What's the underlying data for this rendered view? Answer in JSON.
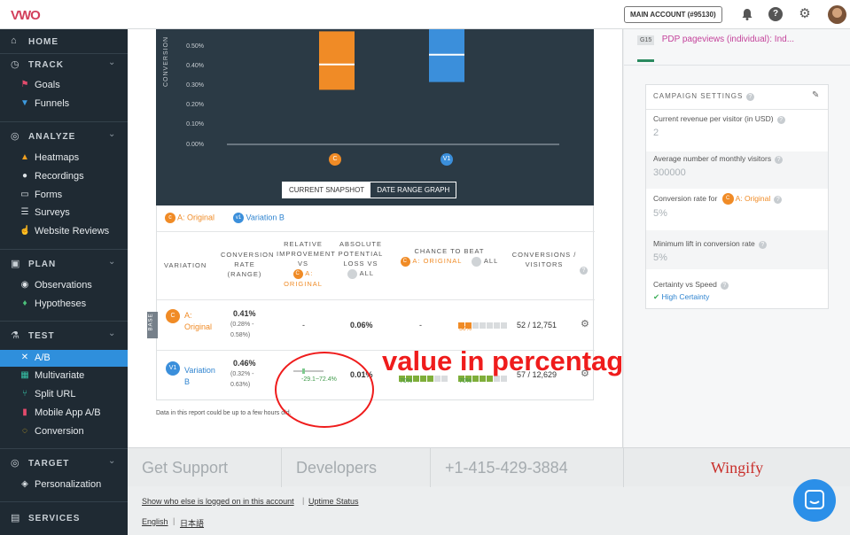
{
  "topbar": {
    "logo": "VWO",
    "account_label": "MAIN ACCOUNT (#95130)",
    "icons": [
      "bell-icon",
      "help-icon",
      "gear-icon"
    ]
  },
  "sidebar": {
    "home": "HOME",
    "track": {
      "title": "TRACK",
      "items": [
        "Goals",
        "Funnels"
      ]
    },
    "analyze": {
      "title": "ANALYZE",
      "items": [
        "Heatmaps",
        "Recordings",
        "Forms",
        "Surveys",
        "Website Reviews"
      ]
    },
    "plan": {
      "title": "PLAN",
      "items": [
        "Observations",
        "Hypotheses"
      ]
    },
    "test": {
      "title": "TEST",
      "items": [
        "A/B",
        "Multivariate",
        "Split URL",
        "Mobile App A/B",
        "Conversion"
      ]
    },
    "target": {
      "title": "TARGET",
      "items": [
        "Personalization"
      ]
    },
    "services": "SERVICES"
  },
  "chart": {
    "ylabel": "CONVERSION",
    "ticks": [
      "0.50%",
      "0.40%",
      "0.30%",
      "0.20%",
      "0.10%",
      "0.00%"
    ],
    "toggle_snapshot": "CURRENT SNAPSHOT",
    "toggle_range": "DATE RANGE GRAPH",
    "marker_c": "C",
    "marker_v1": "V1"
  },
  "chart_data": {
    "type": "box",
    "ylabel": "CONVERSION",
    "ylim": [
      0,
      0.6
    ],
    "categories": [
      "C",
      "V1"
    ],
    "series": [
      {
        "name": "A: Original",
        "low": 0.28,
        "mid": 0.41,
        "high": 0.58,
        "color": "#f08b26"
      },
      {
        "name": "Variation B",
        "low": 0.32,
        "mid": 0.46,
        "high": 0.63,
        "color": "#3b8fdb"
      }
    ]
  },
  "table": {
    "legend_a": "A: Original",
    "legend_b": "Variation B",
    "headers": {
      "variation": "VARIATION",
      "conversion_rate": "CONVERSION RATE (RANGE)",
      "relative": "RELATIVE IMPROVEMENT VS",
      "relative_ref": "A: ORIGINAL",
      "absolute": "ABSOLUTE POTENTIAL LOSS VS",
      "absolute_ref": "ALL",
      "chance": "CHANCE TO BEAT",
      "chance_ref1": "A: ORIGINAL",
      "chance_ref2": "ALL",
      "conversions": "CONVERSIONS / VISITORS"
    },
    "rows": [
      {
        "badge": "C",
        "name": "A: Original",
        "rate": "0.41%",
        "range": "(0.28% - 0.58%)",
        "relative": "-",
        "absolute": "0.06%",
        "chance1": "-",
        "chance2": "30%",
        "conv": "52 / 12,751"
      },
      {
        "badge": "V1",
        "name": "Variation B",
        "rate": "0.46%",
        "range": "(0.32% - 0.63%)",
        "relative": "-29.1~72.4%",
        "absolute": "0.01%",
        "chance1": "70%",
        "chance2": "70%",
        "conv": "57 / 12,629"
      }
    ],
    "chance1_fill": 0.7,
    "chance2_fills": [
      0.3,
      0.7
    ],
    "base_tag": "BASE",
    "note": "Data in this report could be up to a few hours old."
  },
  "annotation": "value in percentage.",
  "right": {
    "goal_tag": "G15",
    "goal_title": "PDP pageviews (individual): Ind...",
    "settings_title": "CAMPAIGN SETTINGS",
    "fields": [
      {
        "label": "Current revenue per visitor (in USD)",
        "value": "2"
      },
      {
        "label": "Average number of monthly visitors",
        "value": "300000"
      },
      {
        "label": "Conversion rate for",
        "ref": "A: Original",
        "value": "5%"
      },
      {
        "label": "Minimum lift in conversion rate",
        "value": "5%"
      },
      {
        "label": "Certainty vs Speed",
        "value": "High Certainty"
      }
    ]
  },
  "footer": {
    "support": "Get Support",
    "developers": "Developers",
    "phone": "+1-415-429-3884",
    "brand": "Wingify",
    "link1": "Show who else is logged on in this account",
    "link2": "Uptime Status",
    "lang1": "English",
    "lang2": "日本語"
  }
}
